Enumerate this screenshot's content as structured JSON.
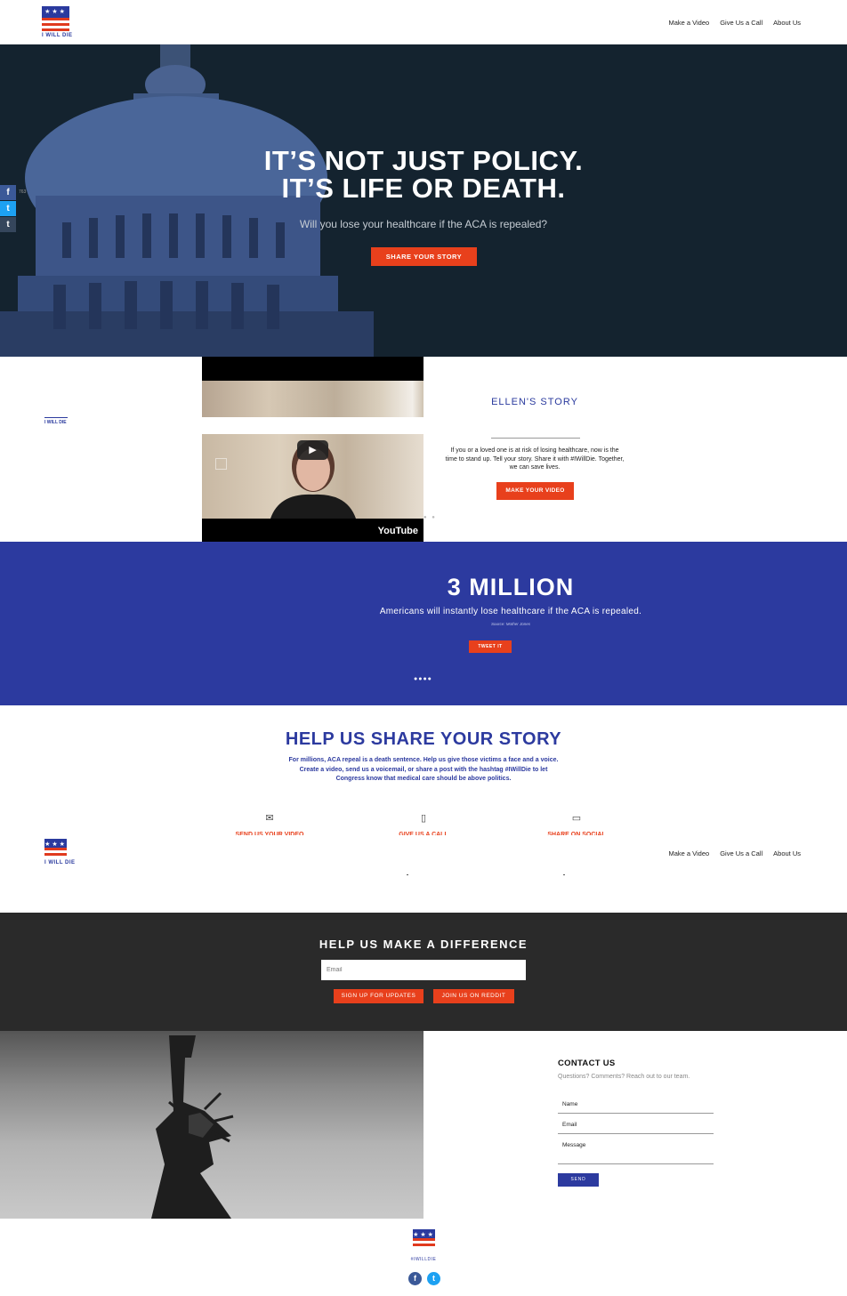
{
  "header": {
    "logo_text": "I WILL DIE",
    "nav": [
      "Make a Video",
      "Give Us a Call",
      "About Us"
    ]
  },
  "social_sidebar": {
    "facebook": "f",
    "twitter": "t",
    "tumblr": "t",
    "count": "763"
  },
  "hero": {
    "headline_1": "IT’S NOT JUST POLICY.",
    "headline_2": "IT’S LIFE OR DEATH.",
    "subhead": "Will you lose your healthcare if the ACA is repealed?",
    "cta": "SHARE YOUR STORY"
  },
  "story": {
    "logo_text": "I WILL DIE",
    "title": "ELLEN'S STORY",
    "body": "If you or a loved one is at risk of losing healthcare, now is the time to stand up. Tell your story. Share it with #IWillDie. Together, we can save lives.",
    "cta": "MAKE YOUR VIDEO",
    "video_brand": "YouTube"
  },
  "stat": {
    "big": "3 MILLION",
    "desc": "Americans will instantly lose healthcare if the ACA is repealed.",
    "source": "Source: Mother Jones",
    "cta": "TWEET IT"
  },
  "help": {
    "title": "HELP US SHARE YOUR STORY",
    "body": "For millions, ACA repeal is a death sentence. Help us give those victims a face and a voice. Create a video, send us a voicemail, or share a post with the hashtag #IWillDie to let Congress know that medical care should be above politics.",
    "items": [
      {
        "icon": "envelope-icon",
        "label": "SEND US YOUR VIDEO"
      },
      {
        "icon": "phone-icon",
        "label": "GIVE US A CALL"
      },
      {
        "icon": "chat-icon",
        "label": "SHARE ON SOCIAL"
      }
    ]
  },
  "sticky_header": {
    "nav": [
      "Make a Video",
      "Give Us a Call",
      "About Us"
    ],
    "logo_text": "I WILL DIE"
  },
  "newsletter": {
    "title": "HELP US MAKE A DIFFERENCE",
    "email_placeholder": "Email",
    "signup": "SIGN UP FOR UPDATES",
    "reddit": "JOIN US ON REDDIT"
  },
  "contact": {
    "title": "CONTACT US",
    "sub": "Questions? Comments? Reach out to our team.",
    "name": "Name",
    "email": "Email",
    "message": "Message",
    "send": "SEND"
  },
  "footer": {
    "tag": "#IWILLDIE",
    "facebook": "f",
    "twitter": "t"
  },
  "colors": {
    "blue": "#2c3a9f",
    "orange": "#e8401c",
    "dark": "#14232f",
    "charcoal": "#2a2a2a"
  }
}
